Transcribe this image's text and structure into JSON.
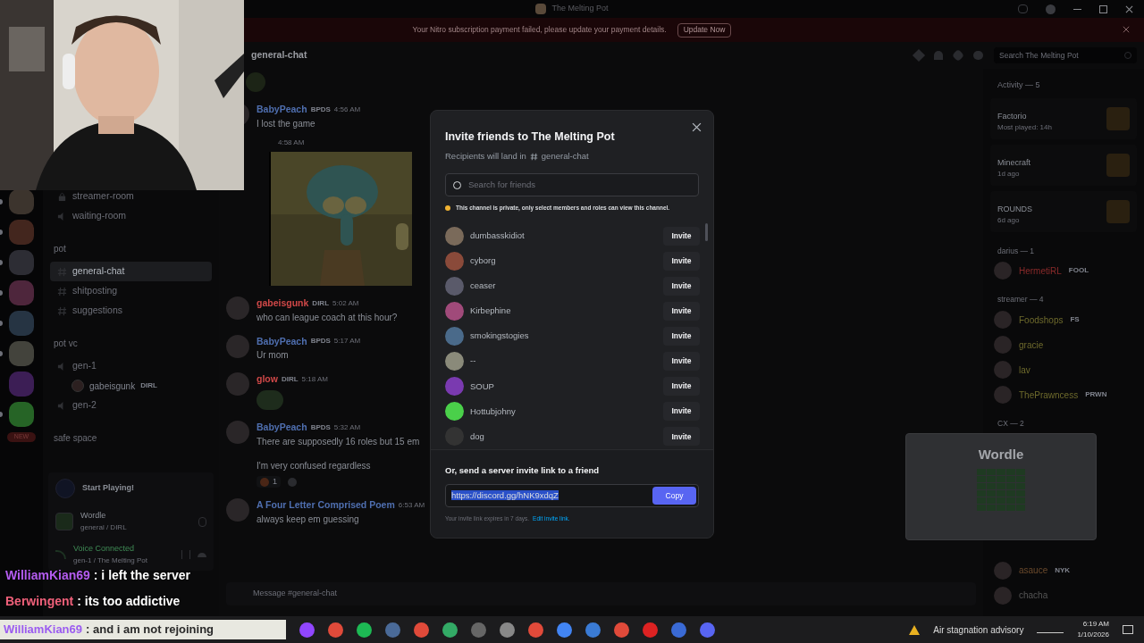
{
  "title_bar": {
    "title": "The Melting Pot"
  },
  "banner": {
    "text": "Your Nitro subscription payment failed, please update your payment details.",
    "button": "Update Now"
  },
  "servers": [
    {
      "unread": true
    },
    {
      "unread": true
    },
    {
      "unread": true
    },
    {
      "unread": true
    },
    {
      "unread": true
    },
    {
      "unread": true
    },
    {
      "unread": false
    },
    {
      "unread": true
    }
  ],
  "new_badge": "NEW",
  "sidebar": {
    "items": [
      {
        "kind": "locked",
        "name": "streamer-room",
        "selected": false
      },
      {
        "kind": "voice",
        "name": "waiting-room",
        "selected": false
      },
      {
        "kind": "category",
        "name": "pot"
      },
      {
        "kind": "text",
        "name": "general-chat",
        "selected": true
      },
      {
        "kind": "text",
        "name": "shitposting",
        "selected": false
      },
      {
        "kind": "text",
        "name": "suggestions",
        "selected": false
      },
      {
        "kind": "category",
        "name": "pot vc"
      },
      {
        "kind": "voice",
        "name": "gen-1",
        "selected": false
      },
      {
        "kind": "member",
        "name": "gabeisgunk",
        "tag": "DIRL"
      },
      {
        "kind": "voice",
        "name": "gen-2",
        "selected": false
      },
      {
        "kind": "category",
        "name": "safe space"
      }
    ]
  },
  "quest": {
    "title": "Start Playing!"
  },
  "app": {
    "name": "Wordle",
    "detail": "general / DIRL"
  },
  "voice": {
    "status": "Voice Connected",
    "detail": "gen-1 / The Melting Pot"
  },
  "header": {
    "channel": "general-chat",
    "search_placeholder": "Search The Melting Pot"
  },
  "messages": [
    {
      "kind": "emoji"
    },
    {
      "kind": "message",
      "author": "BabyPeach",
      "color": "#4f6fb0",
      "tag": "BPDS",
      "time": "4:56 AM",
      "lines": [
        "I lost the game"
      ]
    },
    {
      "time": "4:58 AM"
    },
    {
      "kind": "message",
      "author": "gabeisgunk",
      "color": "#d04848",
      "tag": "DIRL",
      "time": "5:02 AM",
      "lines": [
        "who can league coach at this hour?"
      ]
    },
    {
      "kind": "message",
      "author": "BabyPeach",
      "color": "#4f6fb0",
      "tag": "BPDS",
      "time": "5:17 AM",
      "lines": [
        "Ur mom"
      ]
    },
    {
      "kind": "sticker",
      "author": "glow",
      "color": "#d04848",
      "tag": "DIRL",
      "time": "5:18 AM"
    },
    {
      "kind": "message",
      "author": "BabyPeach",
      "color": "#4f6fb0",
      "tag": "BPDS",
      "time": "5:32 AM",
      "lines": [
        "There are supposedly 16 roles but 15 em",
        "I'm very confused regardless"
      ],
      "reaction": "1"
    },
    {
      "kind": "message",
      "author": "A Four Letter Comprised Poem",
      "color": "#4f6fb0",
      "time": "6:53 AM",
      "lines": [
        "always keep em guessing"
      ]
    }
  ],
  "composer": {
    "placeholder": "Message #general-chat"
  },
  "members": {
    "activity_title": "Activity — 5",
    "activities": [
      {
        "game": "Factorio",
        "detail": "Most played: 14h"
      },
      {
        "game": "Minecraft",
        "detail": "1d ago"
      },
      {
        "game": "ROUNDS",
        "detail": "6d ago"
      }
    ],
    "groups": [
      {
        "title": "darius — 1",
        "members": [
          {
            "name": "HermetiRL",
            "tag": "FOOL",
            "color": "#8a2a2a"
          }
        ]
      },
      {
        "title": "streamer — 4",
        "members": [
          {
            "name": "Foodshops",
            "tag": "FS",
            "color": "#6e6a2c"
          },
          {
            "name": "gracie",
            "color": "#6e6a2c"
          },
          {
            "name": "lav",
            "color": "#6e6a2c"
          },
          {
            "name": "ThePrawncess",
            "tag": "PRWN",
            "color": "#6e6a2c"
          }
        ]
      },
      {
        "title": "CX — 2",
        "members": [
          {
            "name": "asauce",
            "tag": "NYK",
            "color": "#6b4a2c"
          },
          {
            "name": "chacha",
            "color": "#555555"
          }
        ]
      }
    ]
  },
  "wordle": {
    "title": "Wordle"
  },
  "modal": {
    "title": "Invite friends to The Melting Pot",
    "subtitle": "Recipients will land in",
    "channel": "general-chat",
    "search_placeholder": "Search for friends",
    "notice": "This channel is private, only select members and roles can view this channel.",
    "friends": [
      {
        "name": "dumbasskidiot",
        "button": "Invite"
      },
      {
        "name": "cyborg",
        "button": "Invite"
      },
      {
        "name": "ceaser",
        "button": "Invite"
      },
      {
        "name": "Kirbephine",
        "button": "Invite"
      },
      {
        "name": "smokingstogies",
        "button": "Invite"
      },
      {
        "name": "--",
        "button": "Invite"
      },
      {
        "name": "SOUP",
        "button": "Invite"
      },
      {
        "name": "Hottubjohny",
        "button": "Invite"
      },
      {
        "name": "dog",
        "button": "Invite"
      }
    ],
    "link_heading": "Or, send a server invite link to a friend",
    "link": "https://discord.gg/hNK9xdqZ",
    "link_selected": true,
    "copy": "Copy",
    "expiry": "Your invite link expires in 7 days.",
    "edit_link": "Edit invite link."
  },
  "stream_chat": [
    {
      "user": "WilliamKian69",
      "color": "#b45cf0",
      "text": ": i left the server"
    },
    {
      "user": "Berwingent",
      "color": "#f0607a",
      "text": ": its too addictive"
    },
    {
      "user": "WilliamKian69",
      "color": "#9b5cf0",
      "text": ": and i am not rejoining"
    }
  ],
  "taskbar": {
    "weather": "Air stagnation advisory",
    "time": "6:19 AM",
    "date": "1/10/2026"
  }
}
